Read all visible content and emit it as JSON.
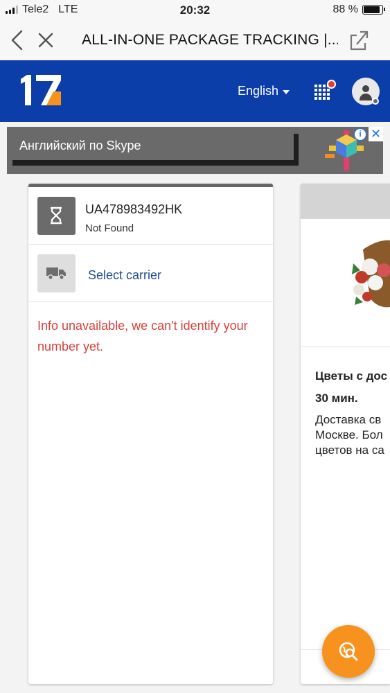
{
  "status_bar": {
    "carrier": "Tele2",
    "network": "LTE",
    "time": "20:32",
    "battery": "88 %",
    "battery_level": 0.88
  },
  "browser": {
    "title": "ALL-IN-ONE PACKAGE TRACKING |..."
  },
  "header": {
    "logo_text": "17",
    "language": "English",
    "brand_color": "#0b3ea8",
    "accent_color": "#f7921e"
  },
  "ad_banner": {
    "text": "Английский по Skype",
    "info_icon": "i",
    "close_icon": "✕"
  },
  "tracking": {
    "number": "UA478983492HK",
    "status": "Not Found",
    "carrier_action": "Select carrier",
    "message": "Info unavailable, we can't identify your number yet.",
    "message_color": "#d8403a"
  },
  "side_ad": {
    "title": "Цветы с дос\n30 мин.",
    "description": "Доставка св\nМоскве. Бол\nцветов на са"
  }
}
